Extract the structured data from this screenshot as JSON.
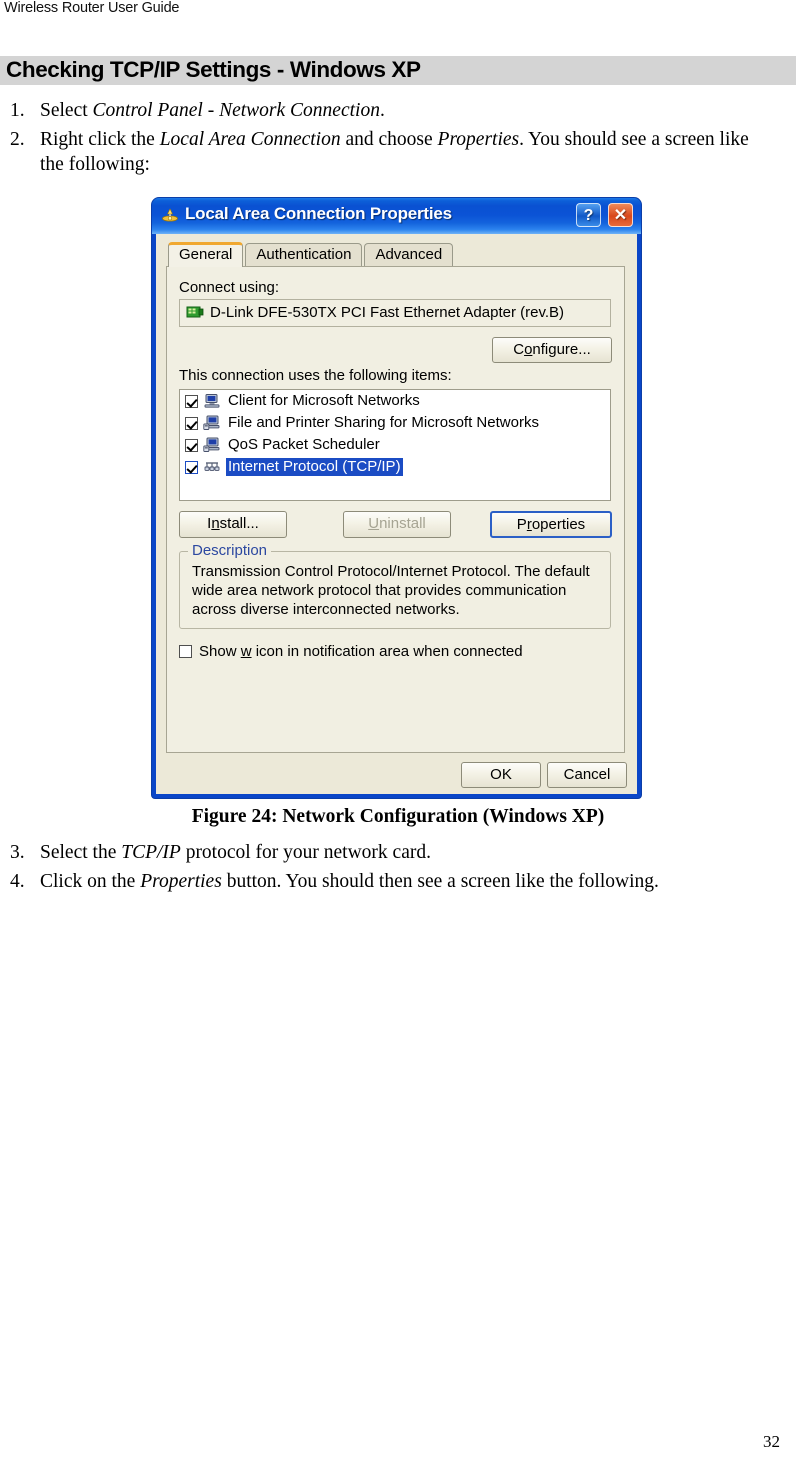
{
  "header": {
    "running_head": "Wireless Router User Guide"
  },
  "section": {
    "title": "Checking TCP/IP Settings - Windows XP"
  },
  "steps_before_figure": [
    {
      "num": "1.",
      "parts": [
        {
          "text": "Select ",
          "italic": false
        },
        {
          "text": "Control Panel - Network Connection",
          "italic": true
        },
        {
          "text": ".",
          "italic": false
        }
      ]
    },
    {
      "num": "2.",
      "parts": [
        {
          "text": "Right click the ",
          "italic": false
        },
        {
          "text": "Local Area Connection",
          "italic": true
        },
        {
          "text": " and choose ",
          "italic": false
        },
        {
          "text": "Properties",
          "italic": true
        },
        {
          "text": ". You should see a screen like the following:",
          "italic": false
        }
      ]
    }
  ],
  "steps_after_figure": [
    {
      "num": "3.",
      "parts": [
        {
          "text": "Select the ",
          "italic": false
        },
        {
          "text": "TCP/IP",
          "italic": true
        },
        {
          "text": " protocol for your network card.",
          "italic": false
        }
      ]
    },
    {
      "num": "4.",
      "parts": [
        {
          "text": "Click on the ",
          "italic": false
        },
        {
          "text": "Properties",
          "italic": true
        },
        {
          "text": " button. You should then see a screen like the following.",
          "italic": false
        }
      ]
    }
  ],
  "figure": {
    "caption": "Figure 24: Network Configuration (Windows  XP)"
  },
  "dialog": {
    "title": "Local Area Connection Properties",
    "title_icon": "network-connection-icon",
    "help_button": "?",
    "close_button": "✕",
    "tabs": [
      {
        "label": "General",
        "active": true
      },
      {
        "label": "Authentication",
        "active": false
      },
      {
        "label": "Advanced",
        "active": false
      }
    ],
    "connect_using_label": "Connect using:",
    "adapter": {
      "icon": "network-adapter-icon",
      "name": "D-Link DFE-530TX PCI Fast Ethernet Adapter (rev.B)"
    },
    "configure_button": {
      "pre": "C",
      "underline": "o",
      "post": "nfigure..."
    },
    "items_label": "This connection uses the following items:",
    "items": [
      {
        "label": "Client for Microsoft Networks",
        "checked": true,
        "selected": false,
        "icon": "client-computer-icon"
      },
      {
        "label": "File and Printer Sharing for Microsoft Networks",
        "checked": true,
        "selected": false,
        "icon": "file-sharing-icon"
      },
      {
        "label": "QoS Packet Scheduler",
        "checked": true,
        "selected": false,
        "icon": "qos-scheduler-icon"
      },
      {
        "label": "Internet Protocol (TCP/IP)",
        "checked": true,
        "selected": true,
        "icon": "protocol-icon"
      }
    ],
    "install_button": {
      "pre": "I",
      "underline": "n",
      "post": "stall..."
    },
    "uninstall_button": {
      "pre": "",
      "underline": "U",
      "post": "ninstall",
      "disabled": true
    },
    "properties_button": {
      "pre": "P",
      "underline": "r",
      "post": "operties",
      "default": true
    },
    "description_legend": "Description",
    "description_text": "Transmission Control Protocol/Internet Protocol. The default wide area network protocol that provides communication across diverse interconnected networks.",
    "notify_checkbox": {
      "pre": "Show ",
      "underline": "w",
      "post": " icon in notification area when connected",
      "checked": false
    },
    "ok_button": "OK",
    "cancel_button": "Cancel"
  },
  "page_number": "32",
  "colors": {
    "banner_gray": "#d4d4d4",
    "dialog_frame_blue": "#0a46c8",
    "dialog_face": "#ece9d8",
    "tabpage_face": "#f1efe2",
    "selection_blue": "#1b4cc4",
    "active_tab_accent": "#f0a830",
    "legend_blue": "#2c48a0",
    "close_button_red": "#d8481c"
  }
}
